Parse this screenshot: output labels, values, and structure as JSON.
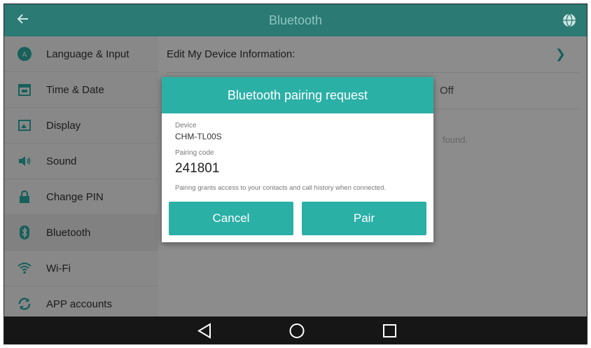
{
  "titlebar": {
    "title": "Bluetooth",
    "back_icon": "arrow-left-icon",
    "action_icon": "globe-icon"
  },
  "sidebar": {
    "items": [
      {
        "label": "Language & Input",
        "icon": "language-icon",
        "color": "#2bb0a6"
      },
      {
        "label": "Time & Date",
        "icon": "calendar-icon",
        "color": "#2bb0a6"
      },
      {
        "label": "Display",
        "icon": "display-icon",
        "color": "#2bb0a6"
      },
      {
        "label": "Sound",
        "icon": "speaker-icon",
        "color": "#2bb0a6"
      },
      {
        "label": "Change PIN",
        "icon": "lock-icon",
        "color": "#2bb0a6"
      },
      {
        "label": "Bluetooth",
        "icon": "bluetooth-icon",
        "color": "#2bb0a6",
        "active": true
      },
      {
        "label": "Wi-Fi",
        "icon": "wifi-icon",
        "color": "#2bb0a6"
      },
      {
        "label": "APP accounts",
        "icon": "sync-icon",
        "color": "#2bb0a6"
      }
    ]
  },
  "content": {
    "edit_device_label": "Edit My Device Information:",
    "bluetooth_state": "Off",
    "hint_text": "found."
  },
  "dialog": {
    "title": "Bluetooth pairing request",
    "device_label": "Device",
    "device_name": "CHM-TL00S",
    "pairing_code_label": "Pairing code",
    "pairing_code": "241801",
    "note": "Pairing grants access to your contacts and call history when connected.",
    "cancel_label": "Cancel",
    "pair_label": "Pair"
  },
  "navbar": {
    "back_icon": "triangle-back-icon",
    "home_icon": "circle-home-icon",
    "recent_icon": "square-recent-icon"
  },
  "colors": {
    "accent": "#2bb0a6",
    "header": "#2b7a74",
    "navbar": "#161616"
  }
}
